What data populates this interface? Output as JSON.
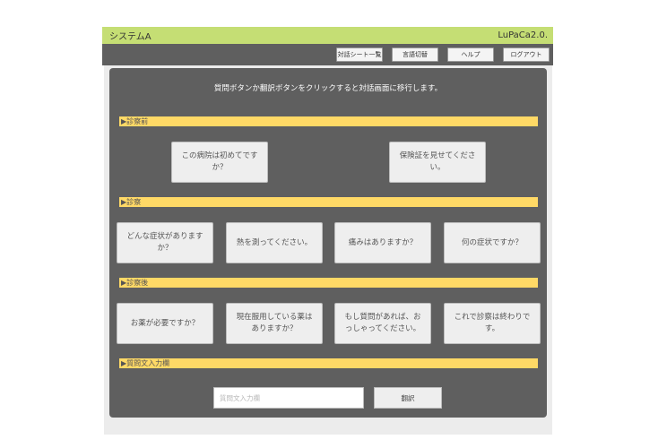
{
  "header": {
    "title": "システムA",
    "version": "LuPaCa2.0."
  },
  "toolbar": {
    "buttons": [
      {
        "label": "対話シート一覧"
      },
      {
        "label": "言語切替"
      },
      {
        "label": "ヘルプ"
      },
      {
        "label": "ログアウト"
      }
    ]
  },
  "main": {
    "instruction": "質問ボタンか翻訳ボタンをクリックすると対話画面に移行します。",
    "sections": [
      {
        "title": "▶診察前",
        "questions": [
          "この病院は初めてですか？",
          "保険証を見せてください。"
        ]
      },
      {
        "title": "▶診察",
        "questions": [
          "どんな症状がありますか？",
          "熱を測ってください。",
          "痛みはありますか？",
          "何の症状ですか？"
        ]
      },
      {
        "title": "▶診察後",
        "questions": [
          "お薬が必要ですか？",
          "現在服用している薬はありますか？",
          "もし質問があれば、おっしゃってください。",
          "これで診察は終わりです。"
        ]
      },
      {
        "title": "▶質問文入力欄"
      }
    ],
    "input": {
      "placeholder": "質問文入力欄",
      "value": ""
    },
    "translate_label": "翻訳"
  }
}
